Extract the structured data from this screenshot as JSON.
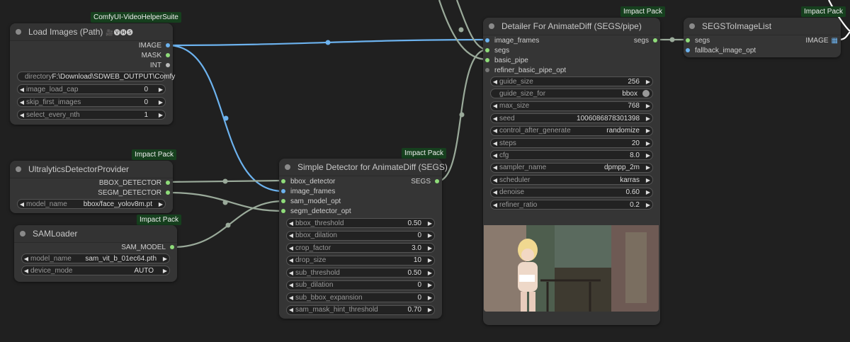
{
  "colors": {
    "image": "#6cb2ee",
    "other": "#a0b8a0",
    "badge": "#16401e"
  },
  "load_images": {
    "badge": "ComfyUI-VideoHelperSuite",
    "title": "Load Images (Path)",
    "title_icons": "🎥🅥🅗🅢",
    "outputs": [
      "IMAGE",
      "MASK",
      "INT"
    ],
    "directory_label": "directory",
    "directory_value": "F:\\Download\\SDWEB_OUTPUT\\Comfy",
    "widgets": [
      {
        "label": "image_load_cap",
        "value": "0"
      },
      {
        "label": "skip_first_images",
        "value": "0"
      },
      {
        "label": "select_every_nth",
        "value": "1"
      }
    ]
  },
  "ultralytics": {
    "badge": "Impact Pack",
    "title": "UltralyticsDetectorProvider",
    "outputs": [
      "BBOX_DETECTOR",
      "SEGM_DETECTOR"
    ],
    "widget": {
      "label": "model_name",
      "value": "bbox/face_yolov8m.pt"
    }
  },
  "samloader": {
    "badge": "Impact Pack",
    "title": "SAMLoader",
    "output": "SAM_MODEL",
    "widgets": [
      {
        "label": "model_name",
        "value": "sam_vit_b_01ec64.pth"
      },
      {
        "label": "device_mode",
        "value": "AUTO"
      }
    ]
  },
  "simple_detector": {
    "badge": "Impact Pack",
    "title": "Simple Detector for AnimateDiff (SEGS)",
    "inputs": [
      "bbox_detector",
      "image_frames",
      "sam_model_opt",
      "segm_detector_opt"
    ],
    "output": "SEGS",
    "widgets": [
      {
        "label": "bbox_threshold",
        "value": "0.50"
      },
      {
        "label": "bbox_dilation",
        "value": "0"
      },
      {
        "label": "crop_factor",
        "value": "3.0"
      },
      {
        "label": "drop_size",
        "value": "10"
      },
      {
        "label": "sub_threshold",
        "value": "0.50"
      },
      {
        "label": "sub_dilation",
        "value": "0"
      },
      {
        "label": "sub_bbox_expansion",
        "value": "0"
      },
      {
        "label": "sam_mask_hint_threshold",
        "value": "0.70"
      }
    ]
  },
  "detailer": {
    "badge": "Impact Pack",
    "title": "Detailer For AnimateDiff (SEGS/pipe)",
    "inputs": [
      "image_frames",
      "segs",
      "basic_pipe",
      "refiner_basic_pipe_opt"
    ],
    "output": "segs",
    "guide_size_for_label": "guide_size_for",
    "guide_size_for_value": "bbox",
    "widgets": [
      {
        "label": "guide_size",
        "value": "256"
      },
      {
        "label": "max_size",
        "value": "768"
      },
      {
        "label": "seed",
        "value": "1006086878301398"
      },
      {
        "label": "control_after_generate",
        "value": "randomize"
      },
      {
        "label": "steps",
        "value": "20"
      },
      {
        "label": "cfg",
        "value": "8.0"
      },
      {
        "label": "sampler_name",
        "value": "dpmpp_2m"
      },
      {
        "label": "scheduler",
        "value": "karras"
      },
      {
        "label": "denoise",
        "value": "0.60"
      },
      {
        "label": "refiner_ratio",
        "value": "0.2"
      }
    ]
  },
  "segs_to_image": {
    "badge": "Impact Pack",
    "title": "SEGSToImageList",
    "inputs": [
      "segs",
      "fallback_image_opt"
    ],
    "output": "IMAGE",
    "output_icon": "▦"
  }
}
